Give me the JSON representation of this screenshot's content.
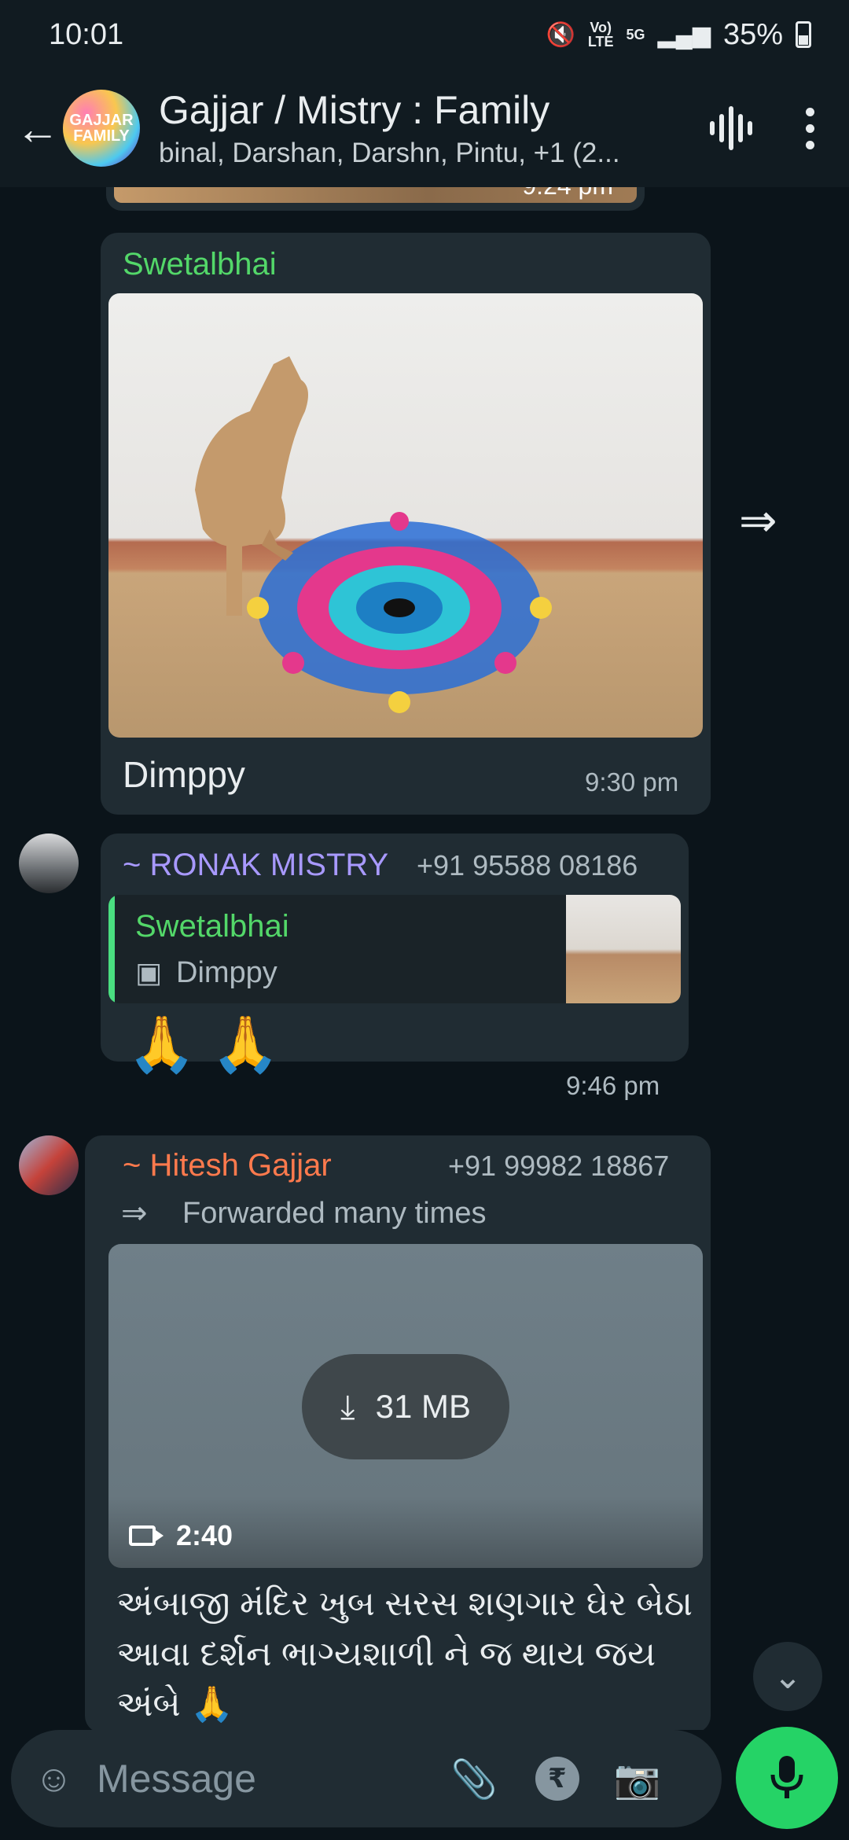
{
  "status": {
    "time": "10:01",
    "network_top": "Vo)",
    "network_bottom": "LTE",
    "fiveg": "5G",
    "battery": "35%"
  },
  "header": {
    "avatar_text": "GAJJAR FAMILY",
    "title": "Gajjar / Mistry : Family",
    "subtitle": "binal, Darshan, Darshn, Pintu, +1 (2..."
  },
  "messages": {
    "prev_time": "9:24 pm",
    "m1": {
      "sender": "Swetalbhai",
      "sender_color": "#53d769",
      "caption": "Dimppy",
      "time": "9:30 pm"
    },
    "m2": {
      "sender": "~ RONAK MISTRY",
      "sender_color": "#a899ff",
      "phone": "+91 95588 08186",
      "quote_author": "Swetalbhai",
      "quote_text": "Dimppy",
      "body": "🙏 🙏",
      "time": "9:46 pm"
    },
    "m3": {
      "sender": "~ Hitesh Gajjar",
      "sender_color": "#ff7a4d",
      "phone": "+91 99982 18867",
      "forwarded": "Forwarded many times",
      "size": "31 MB",
      "duration": "2:40",
      "text": "અંબાજી મંદિર ખુબ સરસ શણગાર ઘેર બેઠા આવા દર્શન ભાગ્યશાળી ને જ થાય જય અંબે 🙏"
    }
  },
  "composer": {
    "placeholder": "Message",
    "rupee_symbol": "₹"
  }
}
